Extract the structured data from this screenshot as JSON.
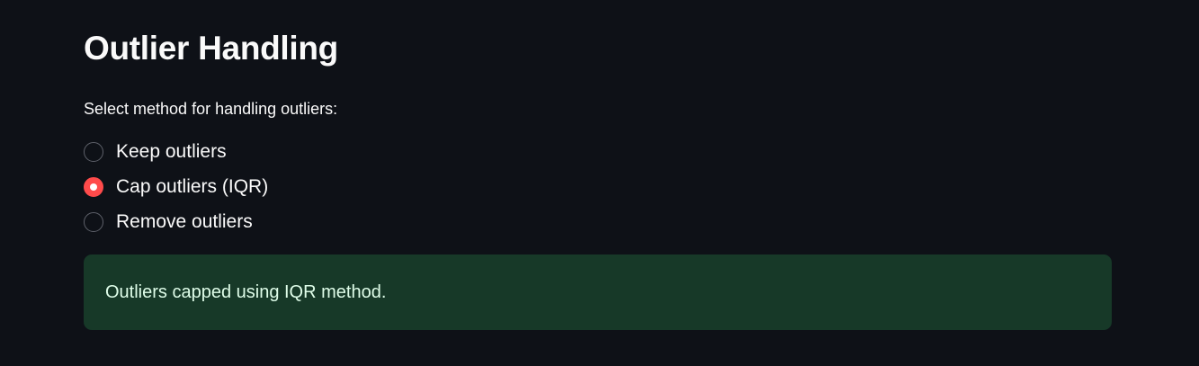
{
  "title": "Outlier Handling",
  "radio": {
    "label": "Select method for handling outliers:",
    "options": [
      {
        "label": "Keep outliers",
        "selected": false
      },
      {
        "label": "Cap outliers (IQR)",
        "selected": true
      },
      {
        "label": "Remove outliers",
        "selected": false
      }
    ]
  },
  "alert": {
    "message": "Outliers capped using IQR method.",
    "type": "success"
  },
  "colors": {
    "background": "#0e1117",
    "accent": "#ff4b4b",
    "success_bg": "#173928",
    "success_text": "#dffde9",
    "text": "#fafafa"
  }
}
